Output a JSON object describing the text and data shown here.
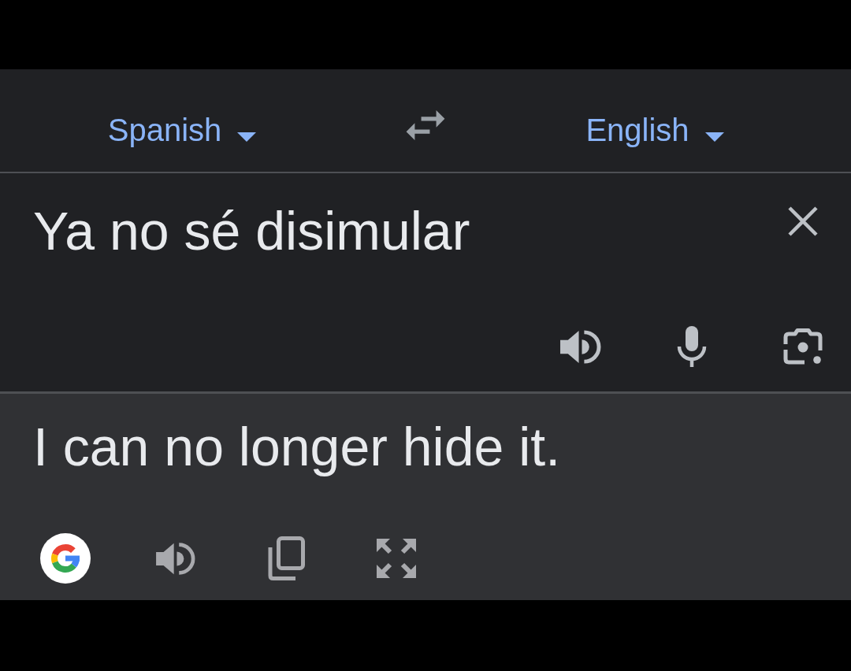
{
  "language_bar": {
    "source_language": {
      "label": "Spanish"
    },
    "target_language": {
      "label": "English"
    }
  },
  "input": {
    "value": "Ya no sé disimular"
  },
  "output": {
    "text": "I can no longer hide it."
  }
}
